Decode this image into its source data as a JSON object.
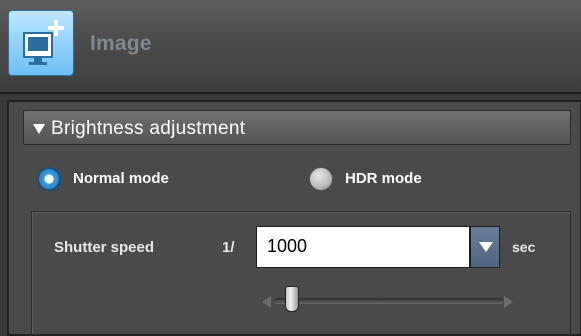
{
  "header": {
    "title": "Image",
    "icon": "image-add-icon"
  },
  "section": {
    "title": "Brightness adjustment",
    "expanded": true
  },
  "modes": {
    "normal": {
      "label": "Normal mode",
      "selected": true
    },
    "hdr": {
      "label": "HDR mode",
      "selected": false
    }
  },
  "shutter": {
    "label": "Shutter speed",
    "prefix": "1/",
    "value": "1000",
    "unit": "sec"
  },
  "colors": {
    "accent": "#3a9fe0",
    "icon_bg": "#8fd0fb",
    "panel_bg": "#4a4a4a"
  }
}
